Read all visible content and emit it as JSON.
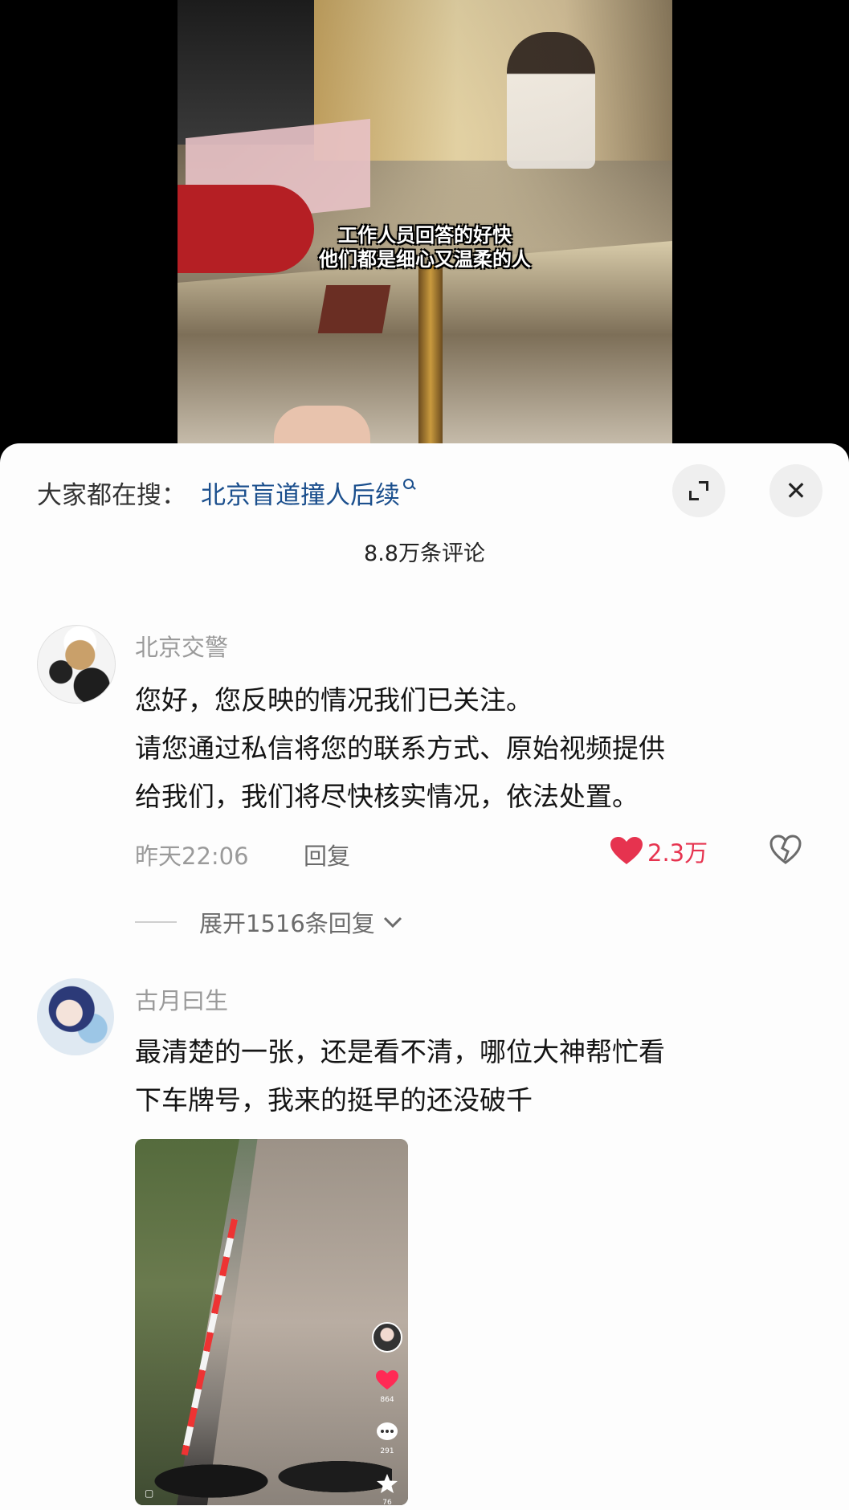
{
  "video": {
    "caption_line1": "工作人员回答的好快",
    "caption_line2": "他们都是细心又温柔的人"
  },
  "panel": {
    "search_prefix": "大家都在搜：",
    "search_term": "北京盲道撞人后续",
    "comment_count": "8.8万条评论",
    "close_glyph": "✕"
  },
  "comments": [
    {
      "username": "北京交警",
      "lines": [
        "您好，您反映的情况我们已关注。",
        "请您通过私信将您的联系方式、原始视频提供",
        "给我们，我们将尽快核实情况，依法处置。"
      ],
      "time": "昨天22:06",
      "reply_label": "回复",
      "likes": "2.3万",
      "expand_replies": "展开1516条回复"
    },
    {
      "username": "古月曰生",
      "lines": [
        "最清楚的一张，还是看不清，哪位大神帮忙看",
        "下车牌号，我来的挺早的还没破千"
      ],
      "image": {
        "like_count": "864",
        "comment_count": "291",
        "fav_count": "76",
        "watermark": "▢"
      }
    }
  ],
  "colors": {
    "link": "#1b4f8d",
    "like": "#e6334f",
    "muted": "#9a9a9a"
  },
  "icons": [
    "search-icon",
    "expand-icon",
    "close-icon",
    "heart-icon",
    "dislike-icon",
    "chevron-down-icon"
  ]
}
